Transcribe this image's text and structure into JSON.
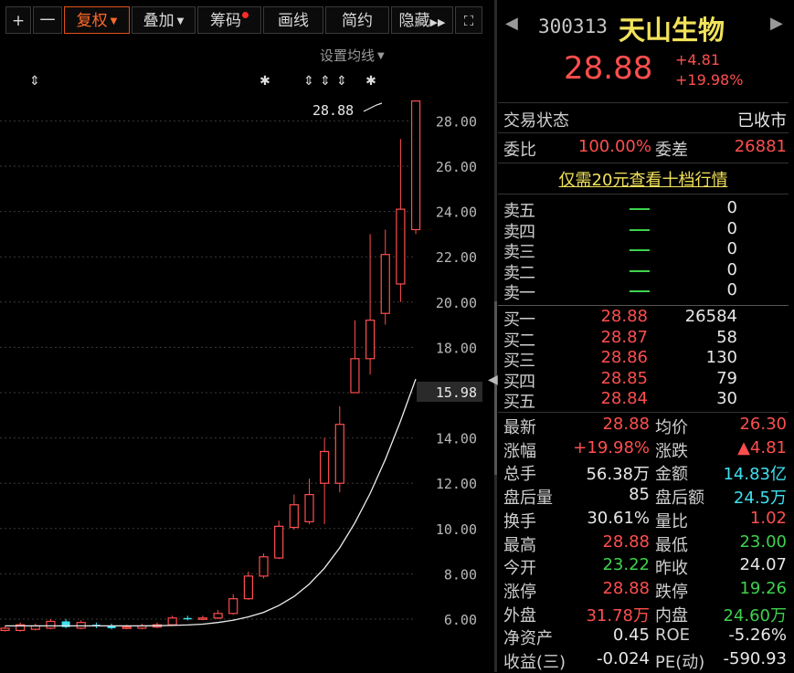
{
  "toolbar": {
    "plus": "+",
    "minus": "一",
    "fuquan": "复权",
    "diejia": "叠加",
    "chouma": "筹码",
    "huaxian": "画线",
    "jianyue": "简约",
    "yincang": "隐藏",
    "expand": "⛶"
  },
  "set_ma": "设置均线",
  "event_markers": [
    "⇕",
    "✱",
    "⇕",
    "⇕",
    "⇕",
    "✱"
  ],
  "chart_data": {
    "type": "candlestick",
    "yticks": [
      "28.00",
      "26.00",
      "24.00",
      "22.00",
      "20.00",
      "18.00",
      "16.00",
      "14.00",
      "12.00",
      "10.00",
      "8.00",
      "6.00"
    ],
    "ylim": [
      5.2,
      29.3
    ],
    "current_price_label": "15.98",
    "last_close_annotation": "28.88",
    "candles": [
      {
        "o": 5.5,
        "c": 5.6,
        "h": 5.7,
        "l": 5.45,
        "col": "red"
      },
      {
        "o": 5.5,
        "c": 5.75,
        "h": 5.85,
        "l": 5.45,
        "col": "red"
      },
      {
        "o": 5.55,
        "c": 5.7,
        "h": 5.8,
        "l": 5.5,
        "col": "red"
      },
      {
        "o": 5.6,
        "c": 5.9,
        "h": 6.0,
        "l": 5.55,
        "col": "red"
      },
      {
        "o": 5.9,
        "c": 5.65,
        "h": 6.0,
        "l": 5.6,
        "col": "cyan"
      },
      {
        "o": 5.6,
        "c": 5.85,
        "h": 5.95,
        "l": 5.55,
        "col": "red"
      },
      {
        "o": 5.75,
        "c": 5.7,
        "h": 5.85,
        "l": 5.6,
        "col": "cyan"
      },
      {
        "o": 5.7,
        "c": 5.6,
        "h": 5.8,
        "l": 5.55,
        "col": "cyan"
      },
      {
        "o": 5.6,
        "c": 5.65,
        "h": 5.75,
        "l": 5.55,
        "col": "red"
      },
      {
        "o": 5.6,
        "c": 5.7,
        "h": 5.8,
        "l": 5.55,
        "col": "red"
      },
      {
        "o": 5.65,
        "c": 5.75,
        "h": 5.85,
        "l": 5.6,
        "col": "red"
      },
      {
        "o": 5.75,
        "c": 6.05,
        "h": 6.15,
        "l": 5.7,
        "col": "red"
      },
      {
        "o": 6.05,
        "c": 6.0,
        "h": 6.15,
        "l": 5.95,
        "col": "cyan"
      },
      {
        "o": 6.0,
        "c": 6.05,
        "h": 6.15,
        "l": 5.95,
        "col": "red"
      },
      {
        "o": 6.05,
        "c": 6.25,
        "h": 6.4,
        "l": 6.0,
        "col": "red"
      },
      {
        "o": 6.25,
        "c": 6.9,
        "h": 7.1,
        "l": 6.2,
        "col": "red"
      },
      {
        "o": 6.9,
        "c": 7.9,
        "h": 8.1,
        "l": 6.85,
        "col": "red"
      },
      {
        "o": 7.9,
        "c": 8.75,
        "h": 8.9,
        "l": 7.8,
        "col": "red"
      },
      {
        "o": 8.7,
        "c": 10.1,
        "h": 10.35,
        "l": 8.65,
        "col": "red"
      },
      {
        "o": 10.05,
        "c": 11.05,
        "h": 11.5,
        "l": 9.95,
        "col": "red"
      },
      {
        "o": 10.3,
        "c": 11.5,
        "h": 12.2,
        "l": 10.2,
        "col": "red"
      },
      {
        "o": 12.0,
        "c": 13.4,
        "h": 14.0,
        "l": 10.2,
        "col": "red"
      },
      {
        "o": 12.0,
        "c": 14.6,
        "h": 15.4,
        "l": 11.6,
        "col": "red"
      },
      {
        "o": 16.0,
        "c": 17.5,
        "h": 19.2,
        "l": 16.2,
        "col": "red"
      },
      {
        "o": 17.5,
        "c": 19.2,
        "h": 23.0,
        "l": 16.8,
        "col": "red"
      },
      {
        "o": 19.5,
        "c": 22.1,
        "h": 23.2,
        "l": 19.0,
        "col": "red"
      },
      {
        "o": 20.8,
        "c": 24.1,
        "h": 27.2,
        "l": 20.0,
        "col": "red"
      },
      {
        "o": 23.2,
        "c": 28.88,
        "h": 28.88,
        "l": 23.0,
        "col": "red"
      }
    ],
    "ma_curve": [
      5.7,
      5.7,
      5.7,
      5.7,
      5.7,
      5.7,
      5.7,
      5.7,
      5.7,
      5.7,
      5.71,
      5.72,
      5.74,
      5.78,
      5.85,
      5.95,
      6.1,
      6.3,
      6.6,
      7.0,
      7.55,
      8.25,
      9.15,
      10.25,
      11.55,
      13.05,
      14.75,
      16.6
    ]
  },
  "quote": {
    "prev": "◀",
    "next": "▶",
    "code": "300313",
    "name": "天山生物",
    "price": "28.88",
    "change": "+4.81",
    "change_pct": "+19.98%",
    "status_label": "交易状态",
    "status_value": "已收市",
    "weibi_label": "委比",
    "weibi_value": "100.00%",
    "weicha_label": "委差",
    "weicha_value": "26881",
    "upsell": "仅需20元查看十档行情"
  },
  "asks": [
    {
      "label": "卖五",
      "vol": "0"
    },
    {
      "label": "卖四",
      "vol": "0"
    },
    {
      "label": "卖三",
      "vol": "0"
    },
    {
      "label": "卖二",
      "vol": "0"
    },
    {
      "label": "卖一",
      "vol": "0"
    }
  ],
  "bids": [
    {
      "label": "买一",
      "price": "28.88",
      "vol": "26584"
    },
    {
      "label": "买二",
      "price": "28.87",
      "vol": "58"
    },
    {
      "label": "买三",
      "price": "28.86",
      "vol": "130"
    },
    {
      "label": "买四",
      "price": "28.85",
      "vol": "79"
    },
    {
      "label": "买五",
      "price": "28.84",
      "vol": "30"
    }
  ],
  "stats": [
    {
      "l1": "最新",
      "v1": "28.88",
      "c1": "red",
      "l2": "均价",
      "v2": "26.30",
      "c2": "red"
    },
    {
      "l1": "涨幅",
      "v1": "+19.98%",
      "c1": "red",
      "l2": "涨跌",
      "v2": "▲4.81",
      "c2": "red"
    },
    {
      "l1": "总手",
      "v1": "56.38万",
      "c1": "white",
      "l2": "金额",
      "v2": "14.83亿",
      "c2": "cyan"
    },
    {
      "l1": "盘后量",
      "v1": "85",
      "c1": "white",
      "l2": "盘后额",
      "v2": "24.5万",
      "c2": "cyan"
    },
    {
      "l1": "换手",
      "v1": "30.61%",
      "c1": "white",
      "l2": "量比",
      "v2": "1.02",
      "c2": "red"
    },
    {
      "l1": "最高",
      "v1": "28.88",
      "c1": "red",
      "l2": "最低",
      "v2": "23.00",
      "c2": "green"
    },
    {
      "l1": "今开",
      "v1": "23.22",
      "c1": "green",
      "l2": "昨收",
      "v2": "24.07",
      "c2": "white"
    },
    {
      "l1": "涨停",
      "v1": "28.88",
      "c1": "red",
      "l2": "跌停",
      "v2": "19.26",
      "c2": "green"
    },
    {
      "l1": "外盘",
      "v1": "31.78万",
      "c1": "red",
      "l2": "内盘",
      "v2": "24.60万",
      "c2": "green"
    },
    {
      "l1": "净资产",
      "v1": "0.45",
      "c1": "white",
      "l2": "ROE",
      "v2": "-5.26%",
      "c2": "white"
    },
    {
      "l1": "收益(三)",
      "v1": "-0.024",
      "c1": "white",
      "l2": "PE(动)",
      "v2": "-590.93",
      "c2": "white"
    }
  ]
}
